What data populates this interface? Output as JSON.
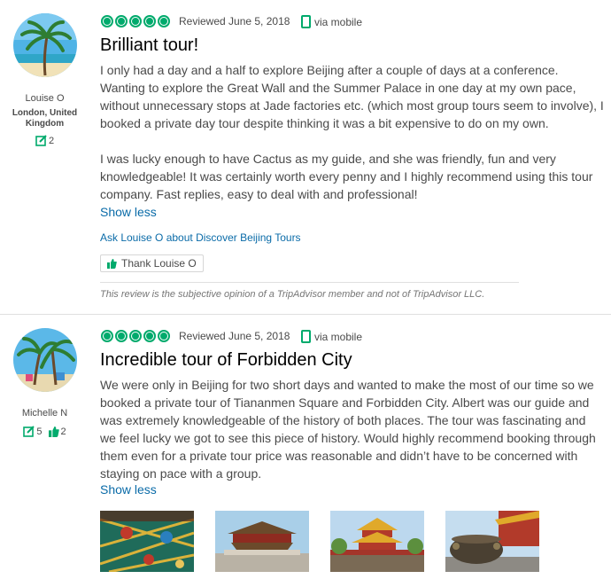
{
  "colors": {
    "accent_green": "#00aa6c",
    "link_blue": "#0a6ba8",
    "text": "#4a4a4a"
  },
  "reviews": [
    {
      "member": {
        "name": "Louise O",
        "location": "London, United Kingdom",
        "reviews_count": "2",
        "avatar_icon": "palm-beach-avatar"
      },
      "rating_bubbles": 5,
      "reviewed_date": "Reviewed June 5, 2018",
      "via": "via mobile",
      "title": "Brilliant tour!",
      "paragraphs": [
        "I only had a day and a half to explore Beijing after a couple of days at a conference. Wanting to explore the Great Wall and the Summer Palace in one day at my own pace, without unnecessary stops at Jade factories etc. (which most group tours seem to involve), I booked a private day tour despite thinking it was a bit expensive to do on my own.",
        "I was lucky enough to have Cactus as my guide, and she was friendly, fun and very knowledgeable! It was certainly worth every penny and I highly recommend using this tour company. Fast replies, easy to deal with and professional!"
      ],
      "show_less": "Show less",
      "ask_link": "Ask Louise O about Discover Beijing Tours",
      "thank_button": "Thank Louise O",
      "disclaimer": "This review is the subjective opinion of a TripAdvisor member and not of TripAdvisor LLC."
    },
    {
      "member": {
        "name": "Michelle N",
        "reviews_count": "5",
        "helpful_count": "2",
        "avatar_icon": "palm-trees-avatar"
      },
      "rating_bubbles": 5,
      "reviewed_date": "Reviewed June 5, 2018",
      "via": "via mobile",
      "title": "Incredible tour of Forbidden City",
      "paragraphs": [
        "We were only in Beijing for two short days and wanted to make the most of our time so we booked a private tour of Tiananmen Square and Forbidden City. Albert was our guide and was extremely knowledgeable of the history of both places. The tour was fascinating and we feel lucky we got to see this piece of history. Would highly recommend booking through them even for a private tour price was reasonable and didn’t have to be concerned with staying on pace with a group."
      ],
      "show_less": "Show less",
      "photos": [
        "painted-ceiling-photo",
        "hall-of-harmony-photo",
        "corner-tower-photo",
        "bronze-vat-photo"
      ]
    }
  ]
}
